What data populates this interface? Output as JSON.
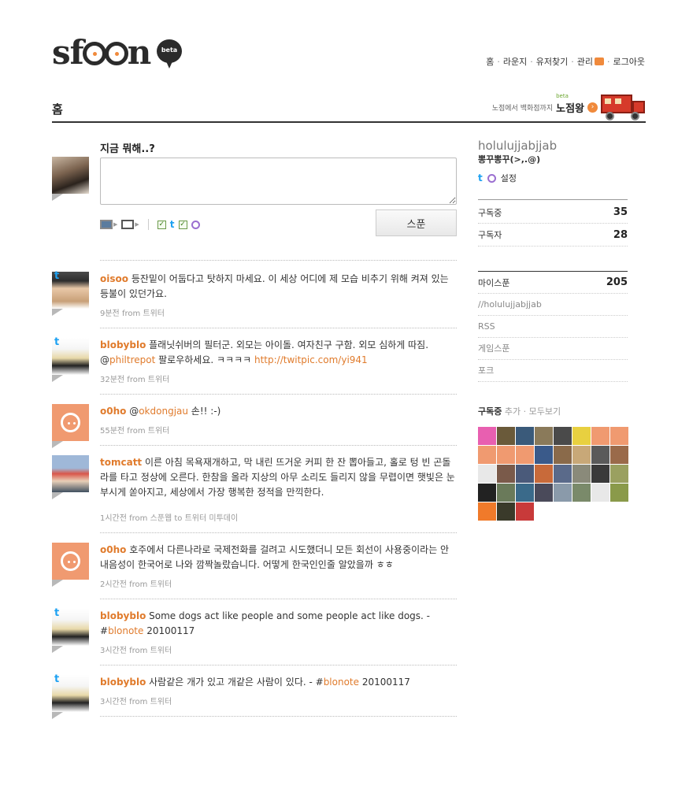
{
  "header": {
    "logo_text": "sfoon",
    "logo_badge": "beta",
    "nav": [
      "홈",
      "라운지",
      "유저찾기",
      "관리",
      "로그아웃"
    ],
    "page_title": "홈",
    "promo_small": "노점에서 백화점까지",
    "promo_beta": "beta",
    "promo_title": "노점왕"
  },
  "compose": {
    "prompt": "지금 뭐해..?",
    "submit_label": "스푼",
    "value": ""
  },
  "feed": [
    {
      "source": "t",
      "avatar": "oisoo-avatar",
      "user": "oisoo",
      "text": "등잔밑이 어둡다고 탓하지 마세요. 이 세상 어디에 제 모습 비추기 위해 켜져 있는 등불이 있던가요.",
      "meta": "9분전 from 트위터"
    },
    {
      "source": "t",
      "avatar": "blobyblo-avatar",
      "user": "blobyblo",
      "text_before": "플래닛쉬버의 필터군. 외모는 아이돌. 여자친구 구함. 외모 심하게 따짐. @",
      "mention": "philtrepot",
      "text_middle": " 팔로우하세요. ㅋㅋㅋㅋ ",
      "link": "http://twitpic.com/yi941",
      "meta": "32분전 from 트위터"
    },
    {
      "source": "",
      "avatar": "o0ho-avatar",
      "user": "o0ho",
      "text_before": "@",
      "mention": "okdongjau",
      "text_after": " 손!! :-)",
      "meta": "55분전 from 트위터"
    },
    {
      "source": "",
      "avatar": "tomcatt-avatar",
      "user": "tomcatt",
      "text": "이른 아침 목욕재개하고, 막 내린 뜨거운 커피 한 잔 뽑아들고, 홀로 텅 빈 곤돌라를 타고 정상에 오른다. 한참을 올라 지상의 아무 소리도 들리지 않을 무렵이면 햇빛은 눈부시게 쏟아지고, 세상에서 가장 행복한 정적을 만끽한다.",
      "meta": "1시간전 from 스푼웹 to 트위터 미투데이"
    },
    {
      "source": "",
      "avatar": "o0ho-avatar",
      "user": "o0ho",
      "text": "호주에서 다른나라로 국제전화를 걸려고 시도했더니 모든 회선이 사용중이라는 안내음성이 한국어로 나와 깜짝놀랐습니다. 어떻게 한국인인줄 알았을까 ㅎㅎ",
      "meta": "2시간전 from 트위터"
    },
    {
      "source": "t",
      "avatar": "blobyblo-avatar",
      "user": "blobyblo",
      "text_before": "Some dogs act like people and some people act like dogs. - #",
      "link": "blonote",
      "text_after": " 20100117",
      "meta": "3시간전 from 트위터"
    },
    {
      "source": "t",
      "avatar": "blobyblo-avatar",
      "user": "blobyblo",
      "text_before": "사람같은 개가 있고 개같은 사람이 있다. - #",
      "link": "blonote",
      "text_after": " 20100117",
      "meta": "3시간전 from 트위터"
    }
  ],
  "sidebar": {
    "username": "holulujjabjjab",
    "nickname": "뽕꾸뽕꾸(>,.@)",
    "services_t": "t",
    "settings_label": "설정",
    "following_label": "구독중",
    "following_count": "35",
    "followers_label": "구독자",
    "followers_count": "28",
    "myspoon_label": "마이스푼",
    "myspoon_count": "205",
    "links": [
      "//holulujjabjjab",
      "RSS",
      "게임스푼",
      "포크"
    ],
    "subs_title": "구독중",
    "subs_add": "추가",
    "subs_all": "모두보기",
    "subs_dot": " · ",
    "grid_colors": [
      "#e85fb0",
      "#6a5a3a",
      "#3a5a7a",
      "#8a7a5a",
      "#4a4a4a",
      "#e8d040",
      "#f09a70",
      "#f09a70",
      "#f09a70",
      "#f09a70",
      "#f09a70",
      "#3a5a8a",
      "#8a6a4a",
      "#c8a878",
      "#5a5a5a",
      "#9a6a4a",
      "#e8e8e8",
      "#7a5a4a",
      "#4a5a7a",
      "#c86a3a",
      "#5a6a8a",
      "#8a8a7a",
      "#3a3a3a",
      "#9aa060",
      "#222222",
      "#6a7a5a",
      "#3a6a8a",
      "#4a4a5a",
      "#8a9aaa",
      "#7a8a6a",
      "#e8e8e8",
      "#8a9a4a",
      "#f07a2a",
      "#3a3a2a",
      "#c83a3a"
    ]
  },
  "colors": {
    "accent": "#e07b2c",
    "rule": "#333333",
    "meta": "#999999"
  }
}
